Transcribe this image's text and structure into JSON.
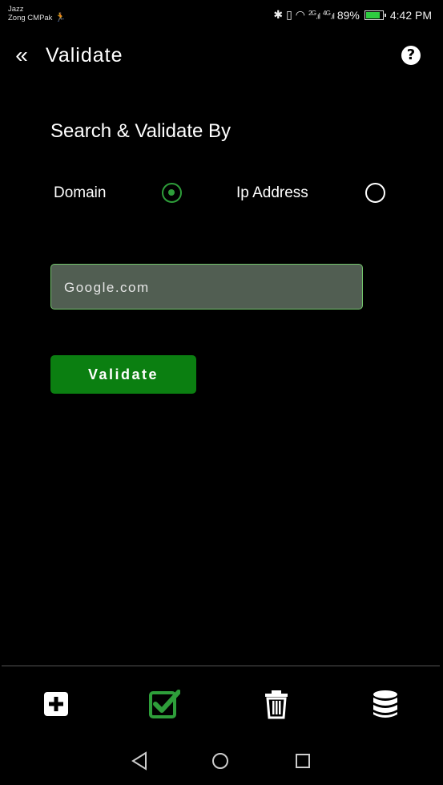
{
  "status_bar": {
    "carrier_1": "Jazz",
    "carrier_2": "Zong CMPak",
    "network_labels": [
      "2G",
      "4G"
    ],
    "battery_percent": "89%",
    "time": "4:42 PM"
  },
  "app_bar": {
    "back_icon": "double-chevron-left-icon",
    "title": "Validate",
    "help_icon": "question-circle-icon"
  },
  "search": {
    "heading": "Search & Validate By",
    "options": [
      {
        "label": "Domain",
        "selected": true
      },
      {
        "label": "Ip Address",
        "selected": false
      }
    ],
    "input_value": "Google.com",
    "button_label": "Validate"
  },
  "bottom_nav": {
    "items": [
      {
        "icon": "add-box-icon"
      },
      {
        "icon": "checkbox-icon",
        "active": true
      },
      {
        "icon": "trash-icon"
      },
      {
        "icon": "database-icon"
      }
    ]
  },
  "colors": {
    "accent": "#2e9e3a",
    "button": "#0b7f11",
    "field_bg": "#515e52",
    "field_border": "#72c56b"
  }
}
